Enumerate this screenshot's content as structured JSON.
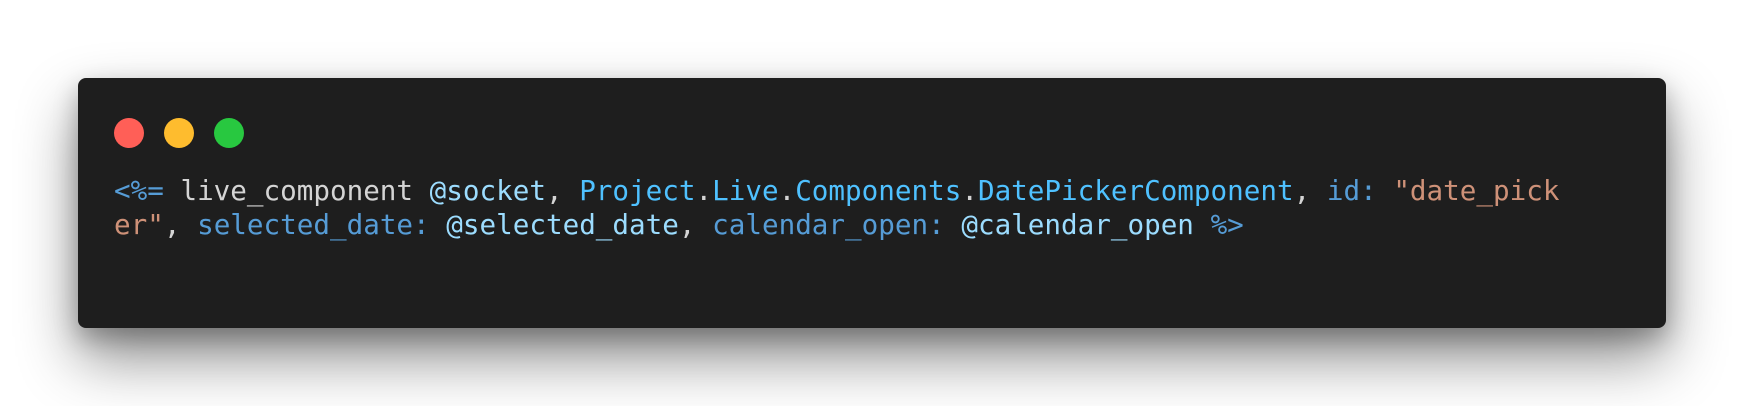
{
  "window": {
    "background": "#1e1e1e",
    "buttons": [
      {
        "name": "close-button",
        "color": "#ff5f57"
      },
      {
        "name": "minimize-button",
        "color": "#febc2e"
      },
      {
        "name": "maximize-button",
        "color": "#28c840"
      }
    ]
  },
  "colors": {
    "tag": "#569cd6",
    "plain": "#d4d4d4",
    "module": "#4fc1ff",
    "punct": "#d4d4d4",
    "key": "#569cd6",
    "string": "#ce9178",
    "assign": "#9cdcfe"
  },
  "code": {
    "line1": [
      {
        "t": "<%=",
        "c": "tag"
      },
      {
        "t": " live_component ",
        "c": "plain"
      },
      {
        "t": "@socket",
        "c": "assign"
      },
      {
        "t": ", ",
        "c": "punct"
      },
      {
        "t": "Project",
        "c": "module"
      },
      {
        "t": ".",
        "c": "punct"
      },
      {
        "t": "Live",
        "c": "module"
      },
      {
        "t": ".",
        "c": "punct"
      },
      {
        "t": "Components",
        "c": "module"
      },
      {
        "t": ".",
        "c": "punct"
      },
      {
        "t": "DatePickerComponent",
        "c": "module"
      },
      {
        "t": ", ",
        "c": "punct"
      },
      {
        "t": "id:",
        "c": "key"
      },
      {
        "t": " ",
        "c": "plain"
      },
      {
        "t": "\"date_pick",
        "c": "string"
      }
    ],
    "line2": [
      {
        "t": "er\"",
        "c": "string"
      },
      {
        "t": ", ",
        "c": "punct"
      },
      {
        "t": "selected_date:",
        "c": "key"
      },
      {
        "t": " ",
        "c": "plain"
      },
      {
        "t": "@selected_date",
        "c": "assign"
      },
      {
        "t": ", ",
        "c": "punct"
      },
      {
        "t": "calendar_open:",
        "c": "key"
      },
      {
        "t": " ",
        "c": "plain"
      },
      {
        "t": "@calendar_open",
        "c": "assign"
      },
      {
        "t": " ",
        "c": "plain"
      },
      {
        "t": "%>",
        "c": "tag"
      }
    ]
  }
}
